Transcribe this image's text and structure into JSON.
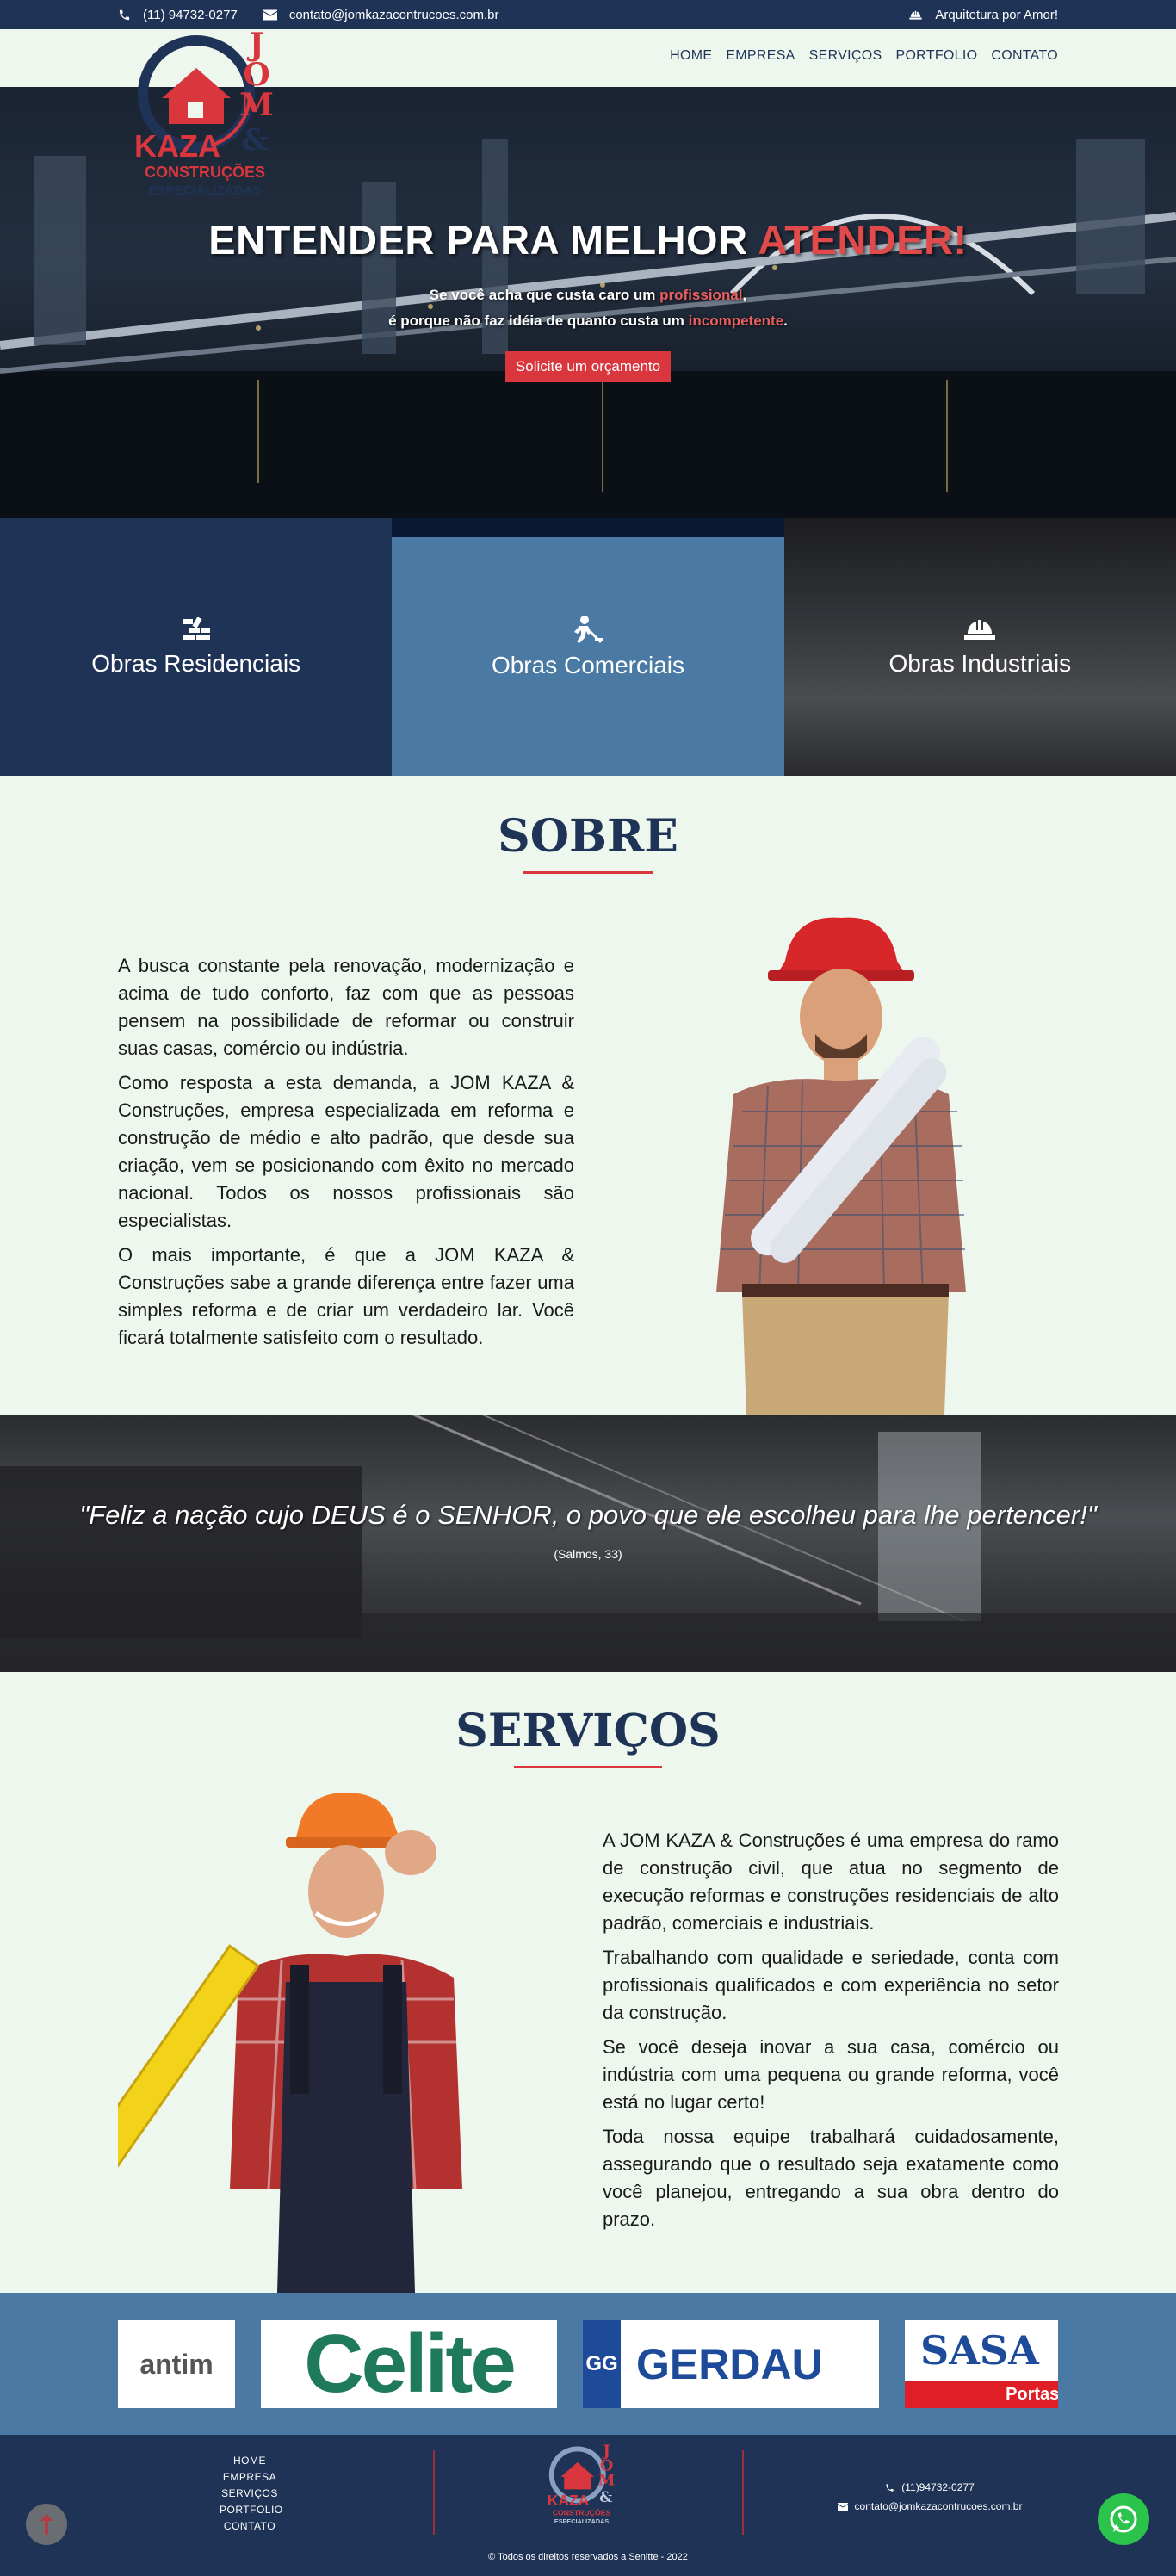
{
  "topbar": {
    "phone": "(11) 94732-0277",
    "email": "contato@jomkazacontrucoes.com.br",
    "tagline": "Arquitetura por Amor!"
  },
  "brand": {
    "logo_text_top": "JOM",
    "logo_text_main": "KAZA",
    "logo_ampersand": "&",
    "logo_line2": "CONSTRUÇÕES",
    "logo_line3": "ESPECIALIZADAS"
  },
  "nav": {
    "items": [
      "HOME",
      "EMPRESA",
      "SERVIÇOS",
      "PORTFOLIO",
      "CONTATO"
    ]
  },
  "hero": {
    "title_main": "ENTENDER PARA MELHOR ",
    "title_accent": "ATENDER!",
    "sub_line1_a": "Se você acha que custa caro um ",
    "sub_line1_hl": "profissional",
    "sub_line1_b": ",",
    "sub_line2_a": "é porque não faz idéia de quanto custa um ",
    "sub_line2_hl": "incompetente",
    "sub_line2_b": ".",
    "cta_label": "Solicite um orçamento"
  },
  "cards": [
    {
      "label": "Obras Residenciais",
      "icon": "bricks-icon"
    },
    {
      "label": "Obras Comerciais",
      "icon": "worker-digging-icon"
    },
    {
      "label": "Obras Industriais",
      "icon": "hard-hat-icon"
    }
  ],
  "sobre": {
    "title": "SOBRE",
    "paragraphs": [
      "A busca constante pela renovação, modernização e acima de tudo conforto, faz com que as pessoas pensem na possibilidade de reformar ou construir suas casas, comércio ou indústria.",
      "Como resposta a esta demanda, a JOM KAZA & Construções, empresa especializada em reforma e construção de médio e alto padrão, que desde sua criação, vem se posicionando com êxito no mercado nacional. Todos os nossos profissionais são especialistas.",
      "O mais importante, é que a JOM KAZA & Construções sabe a grande diferença entre fazer uma simples reforma e de criar um verdadeiro lar. Você ficará totalmente satisfeito com o resultado."
    ]
  },
  "quote": {
    "text": "\"Feliz a nação cujo DEUS é o SENHOR, o povo que ele escolheu para lhe pertencer!\"",
    "reference": "(Salmos, 33)"
  },
  "servicos": {
    "title": "SERVIÇOS",
    "paragraphs": [
      "A JOM KAZA & Construções é uma empresa do ramo de construção civil, que atua no segmento de execução reformas e construções residenciais de alto padrão, comerciais e industriais.",
      "Trabalhando com qualidade e seriedade, conta com profissionais qualificados e com experiência no setor da construção.",
      "Se você deseja inovar a sua casa, comércio ou indústria com uma pequena ou grande reforma, você está no lugar certo!",
      "Toda nossa equipe trabalhará cuidadosamente, assegurando que o resultado seja exatamente como você planejou, entregando a sua obra dentro do prazo."
    ]
  },
  "partners": {
    "logos": [
      {
        "name": "antim",
        "text": "antim"
      },
      {
        "name": "celite",
        "text": "Celite"
      },
      {
        "name": "gerdau",
        "text": "GERDAU",
        "badge": "GG"
      },
      {
        "name": "sasazaki",
        "text": "SASA",
        "sub": "Portas e"
      }
    ]
  },
  "footer": {
    "links": [
      "HOME",
      "EMPRESA",
      "SERVIÇOS",
      "PORTFOLIO",
      "CONTATO"
    ],
    "phone": "(11)94732-0277",
    "email": "contato@jomkazacontrucoes.com.br",
    "copyright": "© Todos os direitos reservados a Senltte - 2022"
  },
  "colors": {
    "navy": "#1f3357",
    "red": "#d9363e",
    "steel_blue": "#4a7aa3",
    "bg": "#eef7ee",
    "whatsapp": "#2bc34c"
  }
}
